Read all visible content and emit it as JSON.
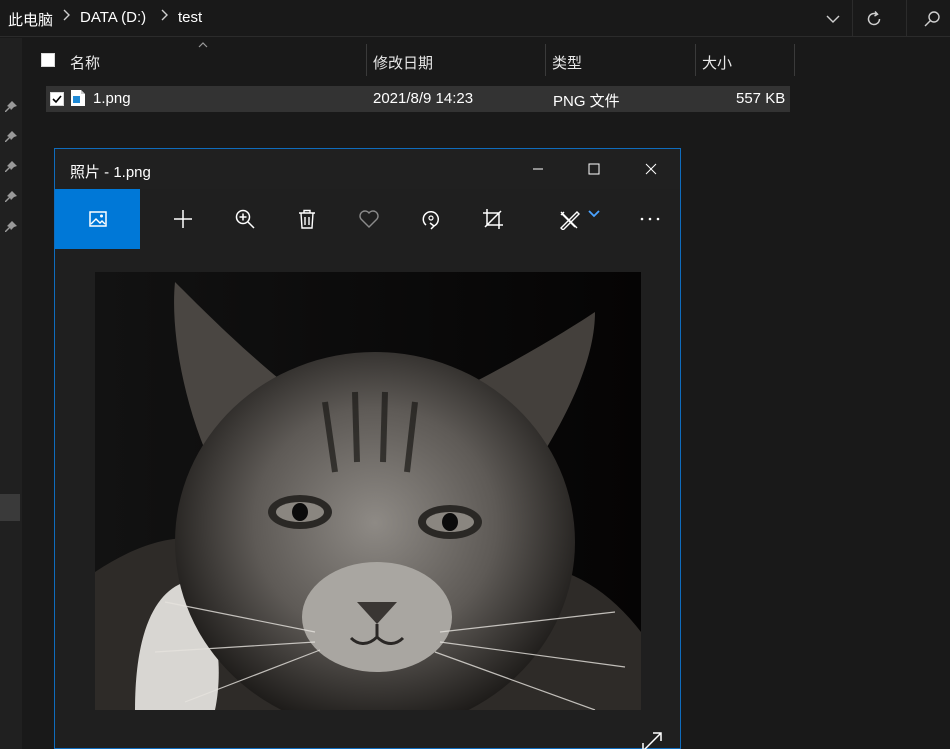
{
  "address": {
    "crumbs": [
      "此电脑",
      "DATA (D:)",
      "test"
    ],
    "separator": ">"
  },
  "columns": {
    "name": "名称",
    "modified": "修改日期",
    "type": "类型",
    "size": "大小"
  },
  "files": [
    {
      "name": "1.png",
      "modified": "2021/8/9 14:23",
      "type": "PNG 文件",
      "size": "557 KB",
      "selected": true
    }
  ],
  "photos": {
    "title": "照片 - 1.png",
    "toolbar": [
      "image-icon",
      "add-icon",
      "zoom-in-icon",
      "delete-icon",
      "heart-icon",
      "rotate-icon",
      "crop-icon",
      "edit-icon",
      "chevron-down-icon",
      "more-icon"
    ],
    "accent": "#0078d7"
  },
  "colors": {
    "background": "#191919",
    "window_border": "#0f6cbd",
    "row_selected": "#333333"
  }
}
